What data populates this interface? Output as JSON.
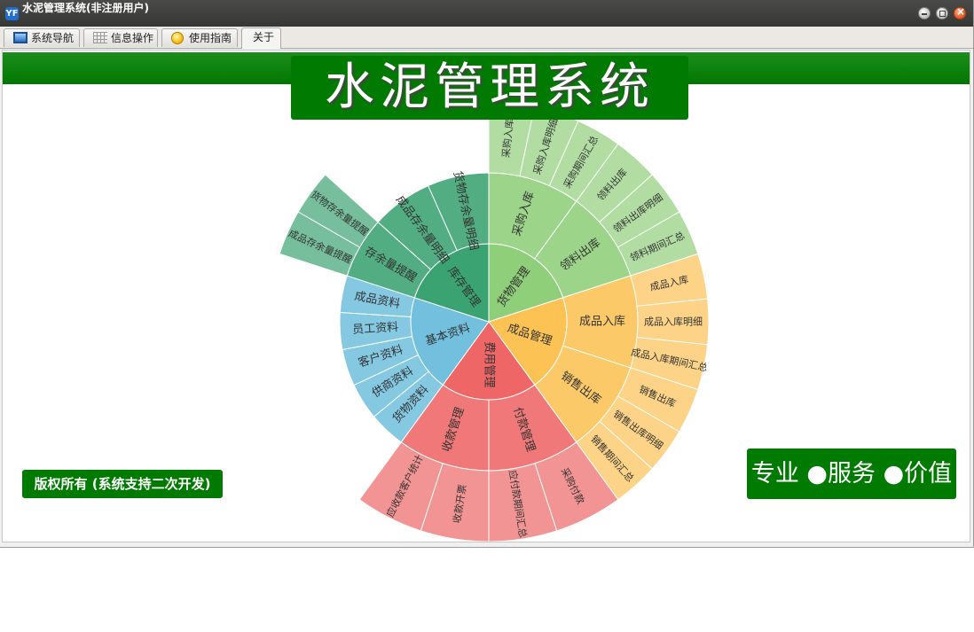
{
  "window": {
    "title": "水泥管理系统(非注册用户)",
    "app_icon_glyph": "YF"
  },
  "tabs": [
    {
      "label": "系统导航",
      "icon": "monitor-icon"
    },
    {
      "label": "信息操作",
      "icon": "grid-icon"
    },
    {
      "label": "使用指南",
      "icon": "bulb-icon"
    },
    {
      "label": "关于",
      "icon": ""
    }
  ],
  "active_tab": "关于",
  "main": {
    "system_title": "水泥管理系统",
    "copyright": "版权所有 (系统支持二次开发)",
    "slogan": "专业 ●服务 ●价值"
  },
  "colors": {
    "brand_green": "#007a00",
    "goods": "#8fcf7a",
    "product": "#fcc254",
    "expense": "#ee6666",
    "basic": "#73c0de",
    "stock": "#3ba272"
  },
  "sunburst": {
    "categories": [
      {
        "name": "货物管理",
        "color": "#8fcf7a",
        "children": [
          {
            "name": "采购入库",
            "children": [
              "采购入库",
              "采购入库明细",
              "采购期间汇总"
            ]
          },
          {
            "name": "领料出库",
            "children": [
              "领料出库",
              "领料出库明细",
              "领料期间汇总"
            ]
          }
        ]
      },
      {
        "name": "成品管理",
        "color": "#fcc254",
        "children": [
          {
            "name": "成品入库",
            "children": [
              "成品入库",
              "成品入库明细",
              "成品入库期间汇总"
            ]
          },
          {
            "name": "销售出库",
            "children": [
              "销售出库",
              "销售出库明细",
              "销售期间汇总"
            ]
          }
        ]
      },
      {
        "name": "费用管理",
        "color": "#ee6666",
        "children": [
          {
            "name": "付款管理",
            "children": [
              "采购付款",
              "应付款期间汇总"
            ]
          },
          {
            "name": "收款管理",
            "children": [
              "收款开票",
              "应收款客户统计"
            ]
          }
        ]
      },
      {
        "name": "基本资料",
        "color": "#73c0de",
        "children": [
          {
            "name": "货物资料",
            "children": []
          },
          {
            "name": "供商资料",
            "children": []
          },
          {
            "name": "客户资料",
            "children": []
          },
          {
            "name": "员工资料",
            "children": []
          },
          {
            "name": "成品资料",
            "children": []
          }
        ]
      },
      {
        "name": "库存管理",
        "color": "#3ba272",
        "children": [
          {
            "name": "存余量提醒",
            "children": [
              "成品存余量提醒",
              "货物存余量提醒"
            ]
          },
          {
            "name": "成品存余量明细",
            "children": []
          },
          {
            "name": "货物存余量明细",
            "children": []
          }
        ]
      }
    ]
  }
}
